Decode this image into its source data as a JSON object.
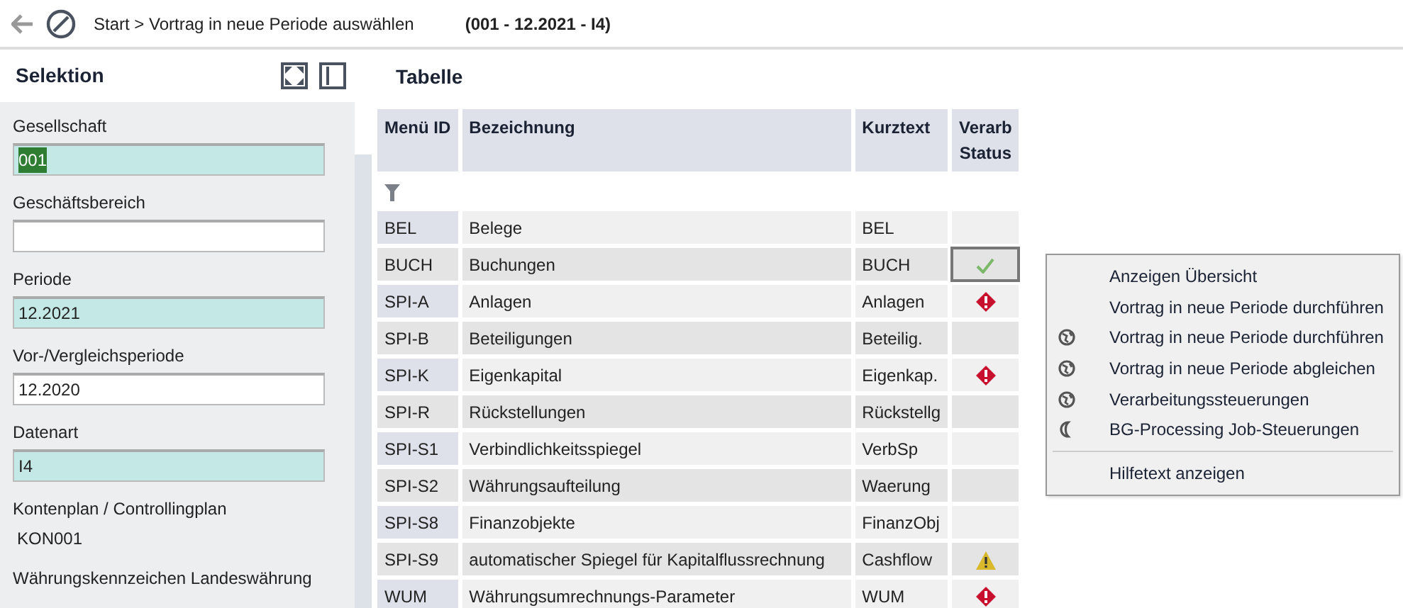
{
  "header": {
    "breadcrumb": "Start > Vortrag in neue Periode auswählen",
    "context": "(001 - 12.2021 - I4)"
  },
  "selection": {
    "title": "Selektion",
    "fields": [
      {
        "label": "Gesellschaft",
        "kind": "input",
        "value": "001",
        "required": true,
        "highlighted": true
      },
      {
        "label": "Geschäftsbereich",
        "kind": "input",
        "required": false
      },
      {
        "label": "Periode",
        "kind": "input",
        "value": "12.2021",
        "required": true,
        "highlighted": false
      },
      {
        "label": "Vor-/Vergleichsperiode",
        "kind": "input",
        "value": "12.2020",
        "required": false,
        "highlighted": false
      },
      {
        "label": "Datenart",
        "kind": "input",
        "value": "I4",
        "required": true,
        "highlighted": false
      },
      {
        "label": "Kontenplan / Controllingplan",
        "kind": "text",
        "value": "KON001"
      },
      {
        "label": "Währungskennzeichen Landeswährung",
        "kind": "label"
      }
    ]
  },
  "table": {
    "title": "Tabelle",
    "columns": [
      "Menü ID",
      "Bezeichnung",
      "Kurztext",
      "Verarb Status"
    ],
    "rows": [
      {
        "id": "BEL",
        "name": "Belege",
        "short": "BEL",
        "kind": "blank",
        "selected": false
      },
      {
        "id": "BUCH",
        "name": "Buchungen",
        "short": "BUCH",
        "kind": "ok",
        "selected": true
      },
      {
        "id": "SPI-A",
        "name": "Anlagen",
        "short": "Anlagen",
        "kind": "error",
        "selected": false
      },
      {
        "id": "SPI-B",
        "name": "Beteiligungen",
        "short": "Beteilig.",
        "kind": "blank",
        "selected": false
      },
      {
        "id": "SPI-K",
        "name": "Eigenkapital",
        "short": "Eigenkap.",
        "kind": "error",
        "selected": false
      },
      {
        "id": "SPI-R",
        "name": "Rückstellungen",
        "short": "Rückstellg",
        "kind": "blank",
        "selected": false
      },
      {
        "id": "SPI-S1",
        "name": "Verbindlichkeitsspiegel",
        "short": "VerbSp",
        "kind": "blank",
        "selected": false
      },
      {
        "id": "SPI-S2",
        "name": "Währungsaufteilung",
        "short": "Waerung",
        "kind": "blank",
        "selected": false
      },
      {
        "id": "SPI-S8",
        "name": "Finanzobjekte",
        "short": "FinanzObj",
        "kind": "blank",
        "selected": false
      },
      {
        "id": "SPI-S9",
        "name": "automatischer Spiegel für Kapitalflussrechnung",
        "short": "Cashflow",
        "kind": "warning",
        "selected": false
      },
      {
        "id": "WUM",
        "name": "Währungsumrechnungs-Parameter",
        "short": "WUM",
        "kind": "error",
        "selected": false
      }
    ]
  },
  "context_menu": {
    "items": [
      {
        "label": "Anzeigen Übersicht",
        "kind": "plain"
      },
      {
        "label": "Vortrag in neue Periode durchführen",
        "kind": "plain"
      },
      {
        "label": "Vortrag in neue Periode durchführen",
        "kind": "globe"
      },
      {
        "label": "Vortrag in neue Periode abgleichen",
        "kind": "globe"
      },
      {
        "label": "Verarbeitungssteuerungen",
        "kind": "globe"
      },
      {
        "label": "BG-Processing Job-Steuerungen",
        "kind": "moon"
      },
      {
        "label": "Hilfetext anzeigen",
        "kind": "plain",
        "separator_before": true
      }
    ]
  }
}
